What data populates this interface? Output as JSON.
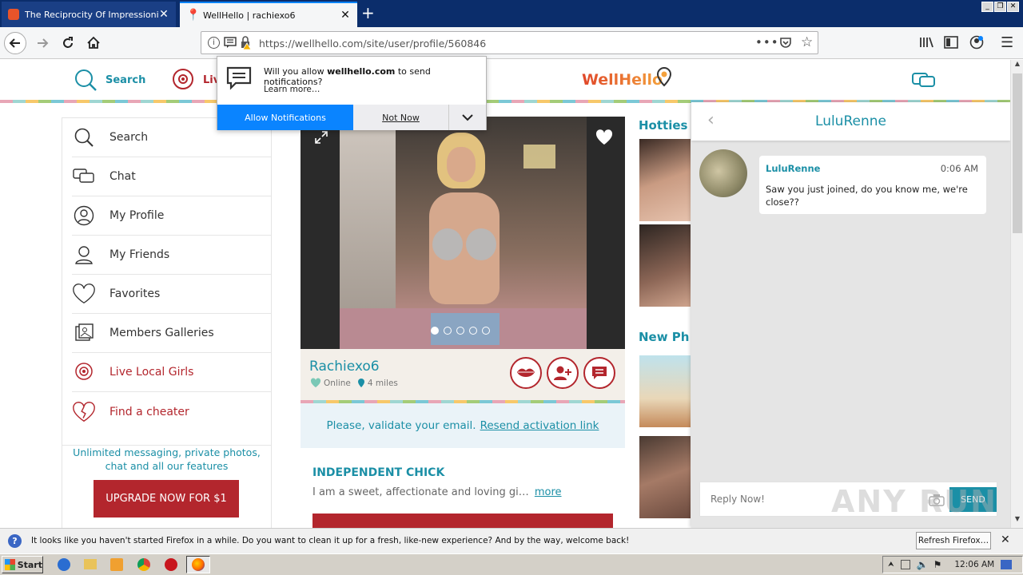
{
  "browser": {
    "tabs": [
      {
        "title": "The Reciprocity Of Impressionism |",
        "active": false
      },
      {
        "title": "WellHello | rachiexo6",
        "active": true
      }
    ],
    "url": "https://wellhello.com/site/user/profile/560846"
  },
  "notification": {
    "question_pre": "Will you allow ",
    "domain": "wellhello.com",
    "question_post": " to send notifications?",
    "learn_more": "Learn more…",
    "allow": "Allow Notifications",
    "not_now": "Not Now"
  },
  "site": {
    "logo": "WellHello",
    "nav": {
      "search": "Search",
      "live": "Live"
    }
  },
  "sidebar": {
    "items": [
      {
        "label": "Search",
        "icon": "search-icon"
      },
      {
        "label": "Chat",
        "icon": "chat-icon"
      },
      {
        "label": "My Profile",
        "icon": "profile-icon"
      },
      {
        "label": "My Friends",
        "icon": "friends-icon"
      },
      {
        "label": "Favorites",
        "icon": "heart-icon"
      },
      {
        "label": "Members Galleries",
        "icon": "gallery-icon"
      },
      {
        "label": "Live Local Girls",
        "icon": "webcam-icon"
      },
      {
        "label": "Find a cheater",
        "icon": "broken-heart-icon"
      }
    ],
    "promo": "Unlimited messaging, private photos, chat and all our features",
    "upgrade": "UPGRADE NOW FOR $1"
  },
  "profile": {
    "username": "Rachiexo6",
    "status": "Online",
    "distance": "4 miles",
    "validate_text": "Please, validate your email.",
    "resend_link": "Resend activation link",
    "headline": "INDEPENDENT CHICK",
    "bio": "I am a sweet, affectionate and loving gi…",
    "more": "more",
    "photo_dots": 5
  },
  "side_sections": {
    "hotties": "Hotties",
    "new_photos": "New Ph"
  },
  "chat": {
    "title": "LuluRenne",
    "message": {
      "sender": "LuluRenne",
      "time": "0:06 AM",
      "text": "Saw you just joined, do you know me, we're close??"
    },
    "reply_placeholder": "Reply Now!",
    "send": "SEND"
  },
  "firefox_bar": {
    "text": "It looks like you haven't started Firefox in a while. Do you want to clean it up for a fresh, like-new experience? And by the way, welcome back!",
    "button": "Refresh Firefox…"
  },
  "taskbar": {
    "start": "Start",
    "clock": "12:06 AM"
  },
  "watermark": "ANY RUN"
}
